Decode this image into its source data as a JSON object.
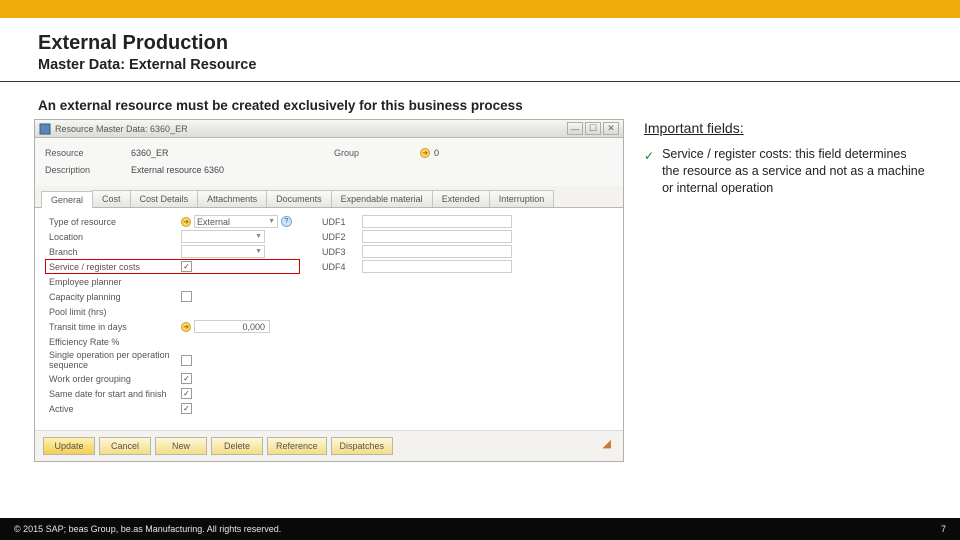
{
  "header": {
    "title": "External Production",
    "subtitle": "Master Data: External Resource"
  },
  "intro": "An external resource must be created exclusively for this business process",
  "window": {
    "title": "Resource Master Data: 6360_ER",
    "top_fields": {
      "resource_label": "Resource",
      "resource_value": "6360_ER",
      "group_label": "Group",
      "group_value": "0",
      "description_label": "Description",
      "description_value": "External resource 6360"
    },
    "tabs": [
      "General",
      "Cost",
      "Cost Details",
      "Attachments",
      "Documents",
      "Expendable material",
      "Extended",
      "Interruption"
    ],
    "active_tab": 0,
    "left_rows": {
      "type_label": "Type of resource",
      "type_value": "External",
      "location_label": "Location",
      "branch_label": "Branch",
      "service_label": "Service / register costs",
      "service_checked": true,
      "empplan_label": "Employee planner",
      "capacity_label": "Capacity planning",
      "capacity_checked": false,
      "pool_label": "Pool limit (hrs)",
      "transit_label": "Transit time in days",
      "transit_value": "0,000",
      "eff_label": "Efficiency Rate %",
      "singleop_label": "Single operation per operation sequence",
      "singleop_checked": false,
      "workorder_label": "Work order grouping",
      "workorder_checked": true,
      "samedate_label": "Same date for start and finish",
      "samedate_checked": true,
      "active_label": "Active",
      "active_checked": true
    },
    "udf": {
      "u1": "UDF1",
      "u2": "UDF2",
      "u3": "UDF3",
      "u4": "UDF4"
    },
    "buttons": {
      "update": "Update",
      "cancel": "Cancel",
      "new": "New",
      "delete": "Delete",
      "reference": "Reference",
      "dispatches": "Dispatches"
    }
  },
  "important": {
    "heading": "Important fields:",
    "bullet1": "Service / register costs: this field determines the resource as a service and not as a machine or internal operation"
  },
  "footer": {
    "copyright": "© 2015 SAP; beas Group, be.as Manufacturing.  All rights reserved.",
    "page": "7"
  }
}
